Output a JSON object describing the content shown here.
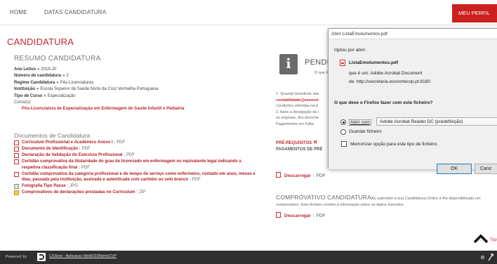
{
  "nav": {
    "home": "HOME",
    "datas": "DATAS CANDIDATURA",
    "meu_perfil": "MEU PERFIL"
  },
  "candidatura": {
    "title": "CANDIDATURA",
    "resumo_title": "RESUMO CANDIDATURA",
    "fields": [
      {
        "label": "Ano Letivo",
        "value": "2019-20"
      },
      {
        "label": "Número de candidatura",
        "value": "2"
      },
      {
        "label": "Regime Candidatura",
        "value": "Pós-Licenciaturas"
      },
      {
        "label": "Instituição",
        "value": "Escola Superior de Saúde Norte da Cruz Vermelha Portuguesa"
      },
      {
        "label": "Tipo de Curso",
        "value": "Especialização"
      }
    ],
    "sep": "»",
    "cursos_label": "Curso(s):",
    "curso": "Pós-Licenciatura de Especialização em Enfermagem de Saúde Infantil e Pediatria"
  },
  "documentos": {
    "title": "Documentos de Candidatura",
    "items": [
      {
        "name": "Curriculum Profissional e Académico Anexo I",
        "format": "PDF",
        "icon": "pdf-icon"
      },
      {
        "name": "Documento de Identificação",
        "format": "PDF",
        "icon": "pdf-icon"
      },
      {
        "name": "Declaração de Validação do Exercício Profissional",
        "format": "PDF",
        "icon": "pdf-icon"
      },
      {
        "name": "Certidão comprovativa da titularidade do grau de licenciado em enfermagem ou equivalente legal indicando a respetiva classificação final",
        "format": "PDF",
        "icon": "pdf-icon"
      },
      {
        "name": "Certidão comprovativa da categoria profissional e do tempo de serviço como enfermeiro, contado em anos, meses e dias, passada pela instituição, assinada e autenticada com carimbo ou selo branco",
        "format": "PDF",
        "icon": "pdf-icon"
      },
      {
        "name": "Fotografia Tipo Passe",
        "format": "JPG",
        "icon": "image-icon"
      },
      {
        "name": "Comprovativos de declarações prestadas no Curriculum",
        "format": "ZIP",
        "icon": "zip-icon"
      }
    ]
  },
  "right": {
    "info_icon": "i",
    "pend_title": "PENDE",
    "que_faz": "O que FAZ",
    "notes": [
      {
        "text": "1. Quando beneficiar das",
        "red": false
      },
      {
        "text": "contabilidade@essnort",
        "red": true
      },
      {
        "text": "condições referidas na p",
        "red": false
      },
      {
        "text": "2. Após a divulgação da l",
        "red": false
      },
      {
        "text": "os originais, dos docume",
        "red": false
      },
      {
        "text": "Pagamentos em Falta",
        "red": false
      }
    ],
    "prereq": "PRÉ-REQUISITOS",
    "pagamentos": "PAGAMENTOS DE PRÉ",
    "descarregar": "Descarregar",
    "pdf": "PDF",
    "comprovativo_title": "COMPROVATIVO CANDIDATURA",
    "comprovativo_text1": "Ao submeter a sua Candidatura Online é-lhe disponibilizado um",
    "comprovativo_text2": "comprovativo. Este ficheiro contém a informação sobre os dados inseridos.",
    "top": "Top"
  },
  "footer": {
    "powered": "Powered by",
    "link_text": "CSSnet - Aplicacao WebESSNorteCVP"
  },
  "dialog": {
    "title": "Abrir ListaEmolumentos.pdf",
    "optou": "Optou por abrir:",
    "filename": "ListaEmolumentos.pdf",
    "que_e_um": "que é um:  Adobe Acrobat Document",
    "de": "de:  http://secretaria.essnortecvp.pt:8180",
    "question": "O que deve o Firefox fazer com este ficheiro?",
    "abrir_com": "Abrir com",
    "app": "Adobe Acrobat Reader DC (predefinição)",
    "guardar": "Guardar ficheiro",
    "memorizar": "Memorizar opção para este tipo de ficheiro.",
    "ok": "OK",
    "cancel": "Canc"
  }
}
